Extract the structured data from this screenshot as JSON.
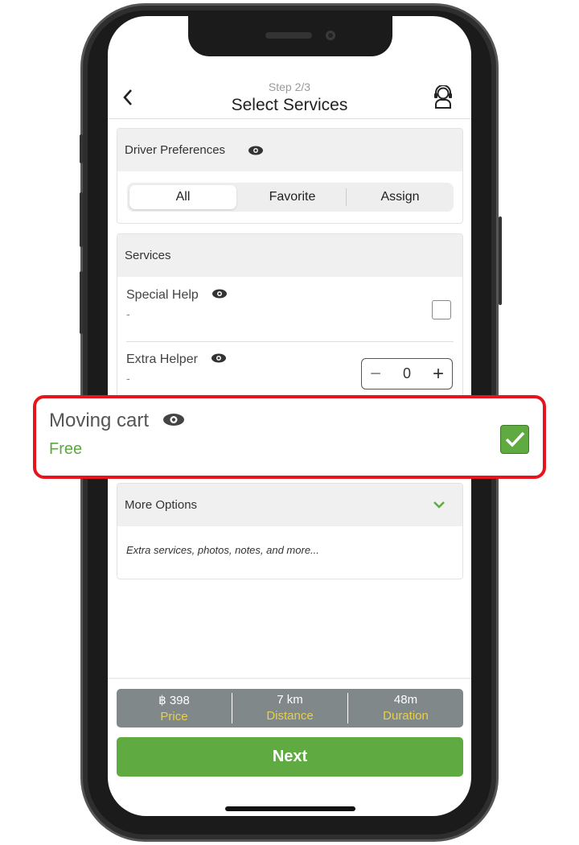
{
  "header": {
    "step": "Step 2/3",
    "title": "Select Services"
  },
  "driver_preferences": {
    "title": "Driver Preferences",
    "tabs": [
      {
        "label": "All",
        "selected": true
      },
      {
        "label": "Favorite",
        "selected": false
      },
      {
        "label": "Assign",
        "selected": false
      }
    ]
  },
  "services": {
    "title": "Services",
    "items": [
      {
        "name": "Special Help",
        "price": "-",
        "checked": false
      },
      {
        "name": "Extra Helper",
        "price": "-",
        "quantity": "0"
      }
    ]
  },
  "highlight": {
    "name": "Moving cart",
    "price": "Free",
    "checked": true
  },
  "more_options": {
    "title": "More Options",
    "description": "Extra services, photos, notes, and more..."
  },
  "summary": [
    {
      "value": "฿ 398",
      "label": "Price"
    },
    {
      "value": "7 km",
      "label": "Distance"
    },
    {
      "value": "48m",
      "label": "Duration"
    }
  ],
  "next_label": "Next",
  "colors": {
    "accent": "#5faa41",
    "highlight_border": "#e8141b",
    "summary_bg": "#808889",
    "summary_label": "#e8d04a"
  }
}
